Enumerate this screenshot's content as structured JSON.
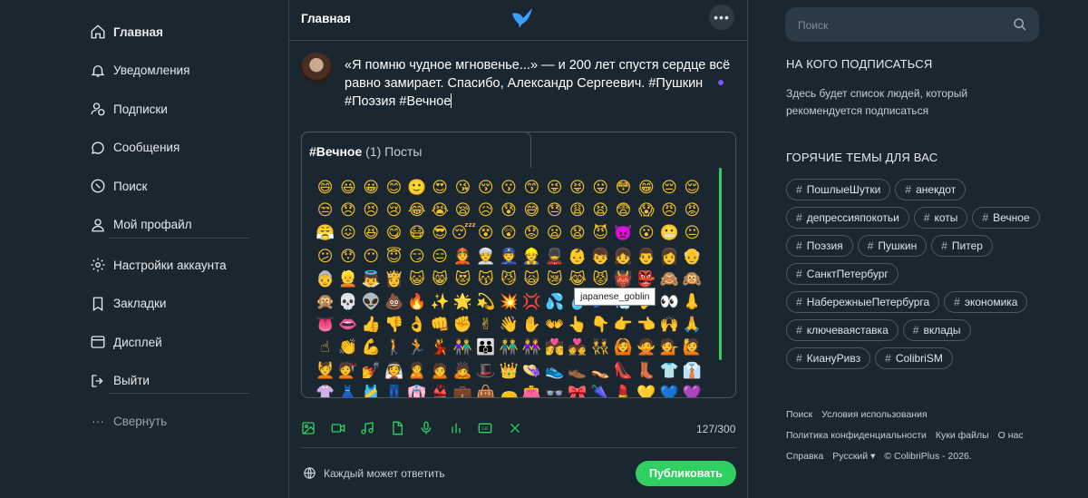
{
  "nav": {
    "items": [
      {
        "label": "Главная",
        "icon": "home-icon"
      },
      {
        "label": "Уведомления",
        "icon": "bell-icon"
      },
      {
        "label": "Подписки",
        "icon": "users-icon"
      },
      {
        "label": "Сообщения",
        "icon": "chat-icon"
      },
      {
        "label": "Поиск",
        "icon": "compass-icon"
      },
      {
        "label": "Мой профайл",
        "icon": "user-icon"
      },
      {
        "label": "Настройки аккаунта",
        "icon": "gear-icon"
      },
      {
        "label": "Закладки",
        "icon": "bookmark-icon"
      },
      {
        "label": "Дисплей",
        "icon": "display-icon"
      },
      {
        "label": "Выйти",
        "icon": "logout-icon"
      },
      {
        "label": "Свернуть",
        "icon": "dots-icon"
      }
    ]
  },
  "header": {
    "title": "Главная",
    "more": "•••"
  },
  "composer": {
    "text": "«Я помню чудное мгновенье...» — и 200 лет спустя сердце всё равно замирает. Спасибо, Александр Сергеевич. #Пушкин #Поэзия #Вечное",
    "suggestion_tag": "#Вечное",
    "suggestion_count": "(1) Посты",
    "tooltip": "japanese_goblin",
    "counter": "127/300",
    "reply_label": "Каждый может ответить",
    "publish_label": "Публиковать",
    "emojis": [
      "😄",
      "😃",
      "😀",
      "😊",
      "🙂",
      "😍",
      "😘",
      "😚",
      "😗",
      "😙",
      "😜",
      "😝",
      "😛",
      "😳",
      "😁",
      "😔",
      "😌",
      "😒",
      "😞",
      "😣",
      "😢",
      "😂",
      "😭",
      "😪",
      "😥",
      "😰",
      "😅",
      "😓",
      "😩",
      "😫",
      "😨",
      "😱",
      "😠",
      "😡",
      "😤",
      "😖",
      "😆",
      "😋",
      "😷",
      "😎",
      "😴",
      "😵",
      "😲",
      "😟",
      "😦",
      "😧",
      "😈",
      "👿",
      "😮",
      "😬",
      "😐",
      "😕",
      "😯",
      "😶",
      "😇",
      "😏",
      "😑",
      "👲",
      "👳",
      "👮",
      "👷",
      "💂",
      "👶",
      "👦",
      "👧",
      "👨",
      "👩",
      "👴",
      "👵",
      "👱",
      "👼",
      "👸",
      "😺",
      "😸",
      "😻",
      "😽",
      "😼",
      "🙀",
      "😿",
      "😹",
      "😾",
      "👹",
      "👺",
      "🙈",
      "🙉",
      "🙊",
      "💀",
      "👽",
      "💩",
      "🔥",
      "✨",
      "🌟",
      "💫",
      "💥",
      "💢",
      "💦",
      "💧",
      "💤",
      "💨",
      "👂",
      "👀",
      "👃",
      "👅",
      "👄",
      "👍",
      "👎",
      "👌",
      "👊",
      "✊",
      "✌",
      "👋",
      "✋",
      "👐",
      "👆",
      "👇",
      "👉",
      "👈",
      "🙌",
      "🙏",
      "☝",
      "👏",
      "💪",
      "🚶",
      "🏃",
      "💃",
      "👫",
      "👪",
      "👬",
      "👭",
      "💏",
      "💑",
      "👯",
      "🙆",
      "🙅",
      "💁",
      "🙋",
      "💆",
      "💇",
      "💅",
      "👰",
      "🙎",
      "🙍",
      "🙇",
      "🎩",
      "👑",
      "👒",
      "👟",
      "👞",
      "👡",
      "👠",
      "👢",
      "👕",
      "👔",
      "👚",
      "👗",
      "🎽",
      "👖",
      "👘",
      "👙",
      "💼",
      "👜",
      "👝",
      "👛",
      "👓",
      "🎀",
      "🌂",
      "💄",
      "💛",
      "💙",
      "💜",
      "💚",
      "❤",
      "💔",
      "💗",
      "💓",
      "💕"
    ]
  },
  "right": {
    "search_placeholder": "Поиск",
    "follow_heading": "НА КОГО ПОДПИСАТЬСЯ",
    "follow_desc": "Здесь будет список людей, который рекомендуется подписаться",
    "topics_heading": "ГОРЯЧИЕ ТЕМЫ ДЛЯ ВАС",
    "tags": [
      "ПошлыеШутки",
      "анекдот",
      "депрессияпокотьи",
      "коты",
      "Вечное",
      "Поэзия",
      "Пушкин",
      "Питер",
      "СанктПетербург",
      "НабережныеПетербурга",
      "экономика",
      "ключеваяставка",
      "вклады",
      "КиануРивз",
      "ColibriSM"
    ],
    "footer_row1": [
      "Поиск",
      "Условия использования"
    ],
    "footer_row2": [
      "Политика конфиденциальности",
      "Куки файлы",
      "О нас"
    ],
    "footer_row3": [
      "Справка",
      "Русский ▾",
      "© ColibriPlus - 2026."
    ]
  },
  "colors": {
    "background": "#1b2730",
    "accent": "#2fcf61",
    "border": "#3a4751"
  }
}
